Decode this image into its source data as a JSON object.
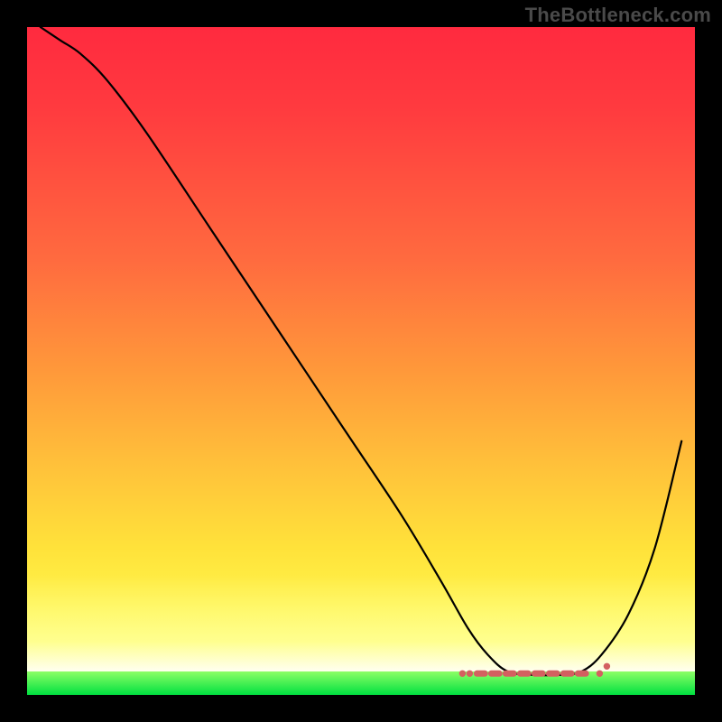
{
  "watermark": "TheBottleneck.com",
  "gradient_colors": {
    "top": "#ff2a3f",
    "mid_upper": "#ff6b3f",
    "mid": "#ffc23a",
    "lower": "#ffff55",
    "pale": "#fbffc0",
    "green_light": "#8cff66",
    "green": "#00e040"
  },
  "chart_data": {
    "type": "line",
    "title": "",
    "xlabel": "",
    "ylabel": "",
    "xlim": [
      0,
      100
    ],
    "ylim": [
      0,
      100
    ],
    "series": [
      {
        "name": "bottleneck-curve",
        "x": [
          2,
          5,
          8,
          12,
          18,
          28,
          38,
          48,
          56,
          62,
          66,
          69,
          72,
          76,
          80,
          83,
          86,
          90,
          94,
          98
        ],
        "y": [
          100,
          98,
          96,
          92,
          84,
          69,
          54,
          39,
          27,
          17,
          10,
          6,
          3.5,
          3,
          3,
          3.5,
          6,
          12,
          22,
          38
        ]
      }
    ],
    "valley_markers": {
      "x_start": 66,
      "x_end": 86,
      "y": 3.2
    }
  }
}
